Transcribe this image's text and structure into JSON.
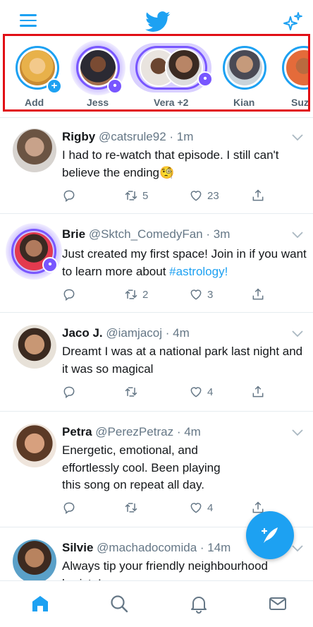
{
  "colors": {
    "accent": "#1da1f2",
    "space": "#7856ff",
    "highlight": "#e10f16",
    "secondary_text": "#657786"
  },
  "header": {
    "menu_icon": "menu-icon",
    "logo_icon": "twitter-bird-icon",
    "sparkle_icon": "sparkle-icon"
  },
  "fleets": [
    {
      "label": "Add",
      "badge": "+"
    },
    {
      "label": "Jess",
      "badge": "space"
    },
    {
      "label": "Vera +2",
      "badge": "space"
    },
    {
      "label": "Kian",
      "badge": ""
    },
    {
      "label": "Suzi",
      "badge": ""
    }
  ],
  "tweets": [
    {
      "name": "Rigby",
      "handle": "@catsrule92",
      "time": "· 1m",
      "text": "I had to re-watch that episode. I still can't believe the ending🧐",
      "text_tag": "",
      "retweets": "5",
      "likes": "23"
    },
    {
      "name": "Brie",
      "handle": "@Sktch_ComedyFan",
      "time": "· 3m",
      "text": "Just created my first space! Join in if you want to learn more about ",
      "text_tag": "#astrology!",
      "retweets": "2",
      "likes": "3"
    },
    {
      "name": "Jaco J.",
      "handle": "@iamjacoj",
      "time": "· 4m",
      "text": "Dreamt I was at a national park last night and it was so magical",
      "text_tag": "",
      "retweets": "",
      "likes": "4"
    },
    {
      "name": "Petra",
      "handle": "@PerezPetraz",
      "time": "· 4m",
      "text": "Energetic, emotional, and effortlessly cool. Been playing this song on repeat all day.",
      "text_tag": "",
      "retweets": "",
      "likes": "4"
    },
    {
      "name": "Silvie",
      "handle": "@machadocomida",
      "time": "· 14m",
      "text": "Always tip your friendly neighbourhood barista!",
      "text_tag": "",
      "retweets": "",
      "likes": ""
    }
  ],
  "compose_icon": "compose-tweet-icon",
  "bottom_nav": [
    "home-icon",
    "search-icon",
    "notifications-icon",
    "messages-icon"
  ]
}
